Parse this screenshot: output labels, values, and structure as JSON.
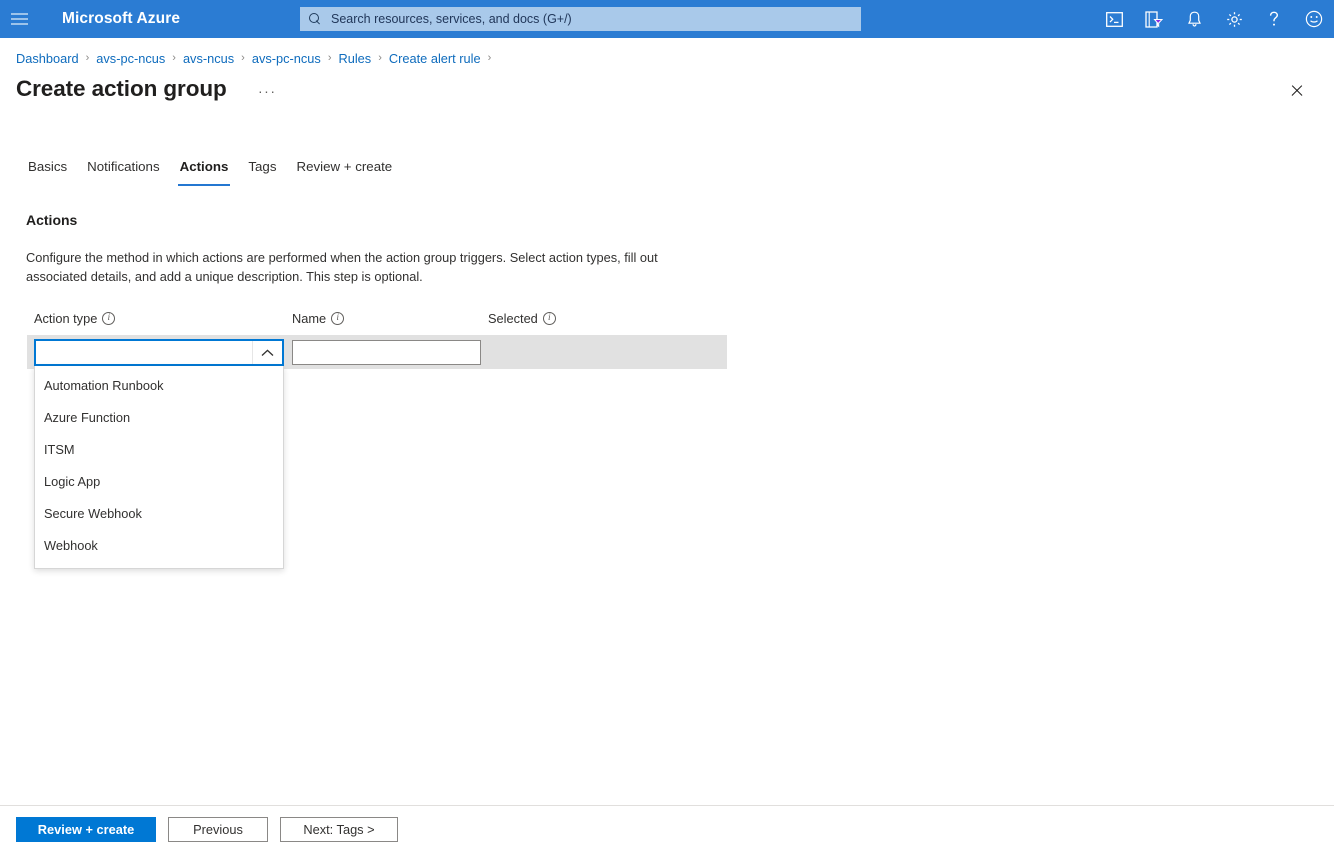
{
  "topbar": {
    "menu_icon": "hamburger-icon",
    "brand": "Microsoft Azure",
    "search": {
      "placeholder": "Search resources, services, and docs (G+/)",
      "icon": "search-icon",
      "value": ""
    },
    "icons": [
      {
        "name": "cloud-shell-icon",
        "title": "Cloud Shell"
      },
      {
        "name": "directories-subscriptions-icon",
        "title": "Directories + subscriptions"
      },
      {
        "name": "notifications-bell-icon",
        "title": "Notifications"
      },
      {
        "name": "settings-gear-icon",
        "title": "Settings"
      },
      {
        "name": "help-question-icon",
        "title": "Help"
      },
      {
        "name": "feedback-smiley-icon",
        "title": "Feedback"
      }
    ]
  },
  "breadcrumb": {
    "separator": "›",
    "items": [
      "Dashboard",
      "avs-pc-ncus",
      "avs-ncus",
      "avs-pc-ncus",
      "Rules",
      "Create alert rule"
    ]
  },
  "header": {
    "title": "Create action group",
    "ellipsis": "···",
    "close_icon": "close-icon"
  },
  "tabs": [
    {
      "label": "Basics",
      "active": false
    },
    {
      "label": "Notifications",
      "active": false
    },
    {
      "label": "Actions",
      "active": true
    },
    {
      "label": "Tags",
      "active": false
    },
    {
      "label": "Review + create",
      "active": false
    }
  ],
  "main": {
    "section_title": "Actions",
    "section_description": "Configure the method in which actions are performed when the action group triggers. Select action types, fill out associated details, and add a unique description. This step is optional.",
    "columns": [
      {
        "label": "Action type",
        "info": "i"
      },
      {
        "label": "Name",
        "info": "i"
      },
      {
        "label": "Selected",
        "info": "i"
      }
    ],
    "action_type": {
      "value": "",
      "placeholder": "",
      "chevron_icon": "chevron-up-icon",
      "expanded": true,
      "options": [
        "Automation Runbook",
        "Azure Function",
        "ITSM",
        "Logic App",
        "Secure Webhook",
        "Webhook"
      ]
    },
    "name_field": {
      "value": "",
      "placeholder": ""
    }
  },
  "footer": {
    "review_create": "Review + create",
    "previous": "Previous",
    "next": "Next: Tags >"
  },
  "colors": {
    "azure_blue": "#2b7cd3",
    "accent": "#0078d4",
    "link": "#0f6cbd",
    "row_bg": "#e1e1e1",
    "tab_underline": "#2477d1"
  }
}
